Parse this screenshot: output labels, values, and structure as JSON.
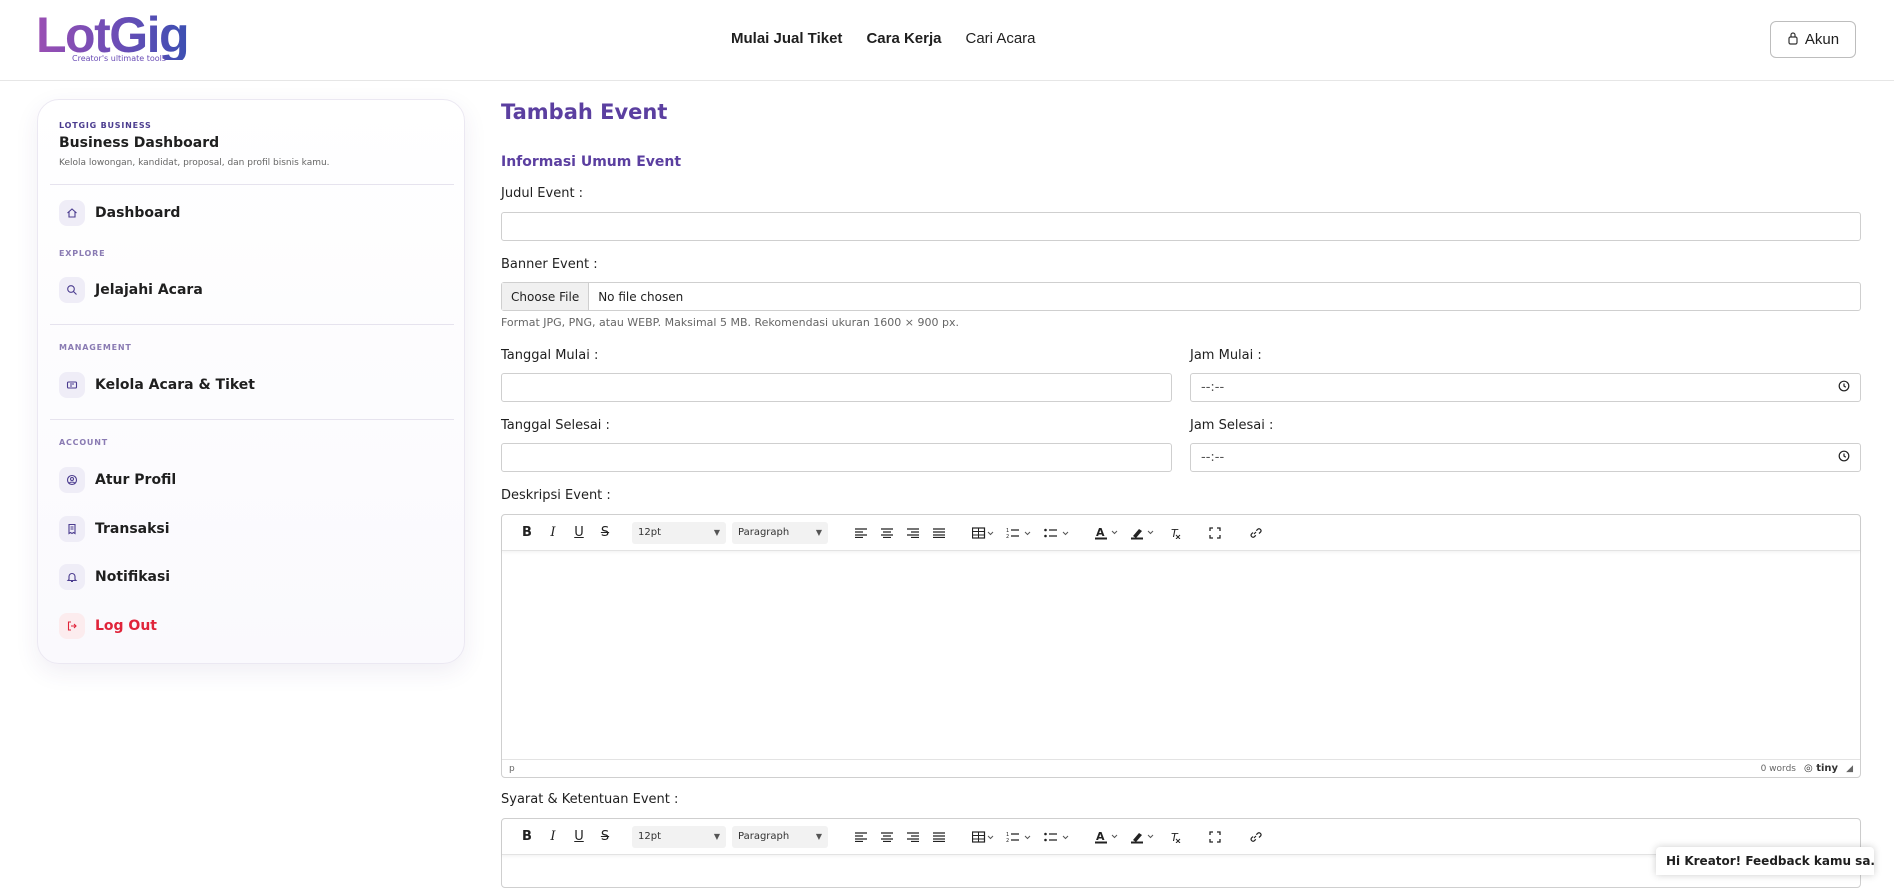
{
  "header": {
    "logo_text": "LotGig",
    "logo_tagline": "Creator's ultimate tools",
    "nav": [
      {
        "label": "Mulai Jual Tiket"
      },
      {
        "label": "Cara Kerja"
      },
      {
        "label": "Cari Acara"
      }
    ],
    "account_label": "Akun"
  },
  "sidebar": {
    "eyebrow": "LOTGIG BUSINESS",
    "title": "Business Dashboard",
    "description": "Kelola lowongan, kandidat, proposal, dan profil bisnis kamu.",
    "dashboard_label": "Dashboard",
    "explore_section": "EXPLORE",
    "explore_item": "Jelajahi Acara",
    "management_section": "MANAGEMENT",
    "management_item": "Kelola Acara & Tiket",
    "account_section": "ACCOUNT",
    "account_items": [
      {
        "label": "Atur Profil",
        "icon": "user-circle-icon"
      },
      {
        "label": "Transaksi",
        "icon": "receipt-icon"
      },
      {
        "label": "Notifikasi",
        "icon": "bell-icon"
      }
    ],
    "logout_label": "Log Out",
    "logout_color": "#e0243a"
  },
  "main": {
    "page_title": "Tambah Event",
    "section_title": "Informasi Umum Event",
    "judul_label": "Judul Event :",
    "judul_value": "",
    "banner_label": "Banner Event :",
    "file_button": "Choose File",
    "file_status": "No file chosen",
    "banner_hint": "Format JPG, PNG, atau WEBP. Maksimal 5 MB. Rekomendasi ukuran 1600 × 900 px.",
    "tanggal_mulai_label": "Tanggal Mulai :",
    "jam_mulai_label": "Jam Mulai :",
    "jam_mulai_value": "--:--",
    "tanggal_selesai_label": "Tanggal Selesai :",
    "jam_selesai_label": "Jam Selesai :",
    "jam_selesai_value": "--:--",
    "deskripsi_label": "Deskripsi Event :",
    "syarat_label": "Syarat & Ketentuan Event :",
    "accent_color": "#5b3fa0"
  },
  "editor": {
    "font_size": "12pt",
    "block_format": "Paragraph",
    "path": "p",
    "word_count": "0 words",
    "brand": "tiny"
  },
  "feedback": {
    "label": "Hi Kreator! Feedback kamu sa..."
  }
}
